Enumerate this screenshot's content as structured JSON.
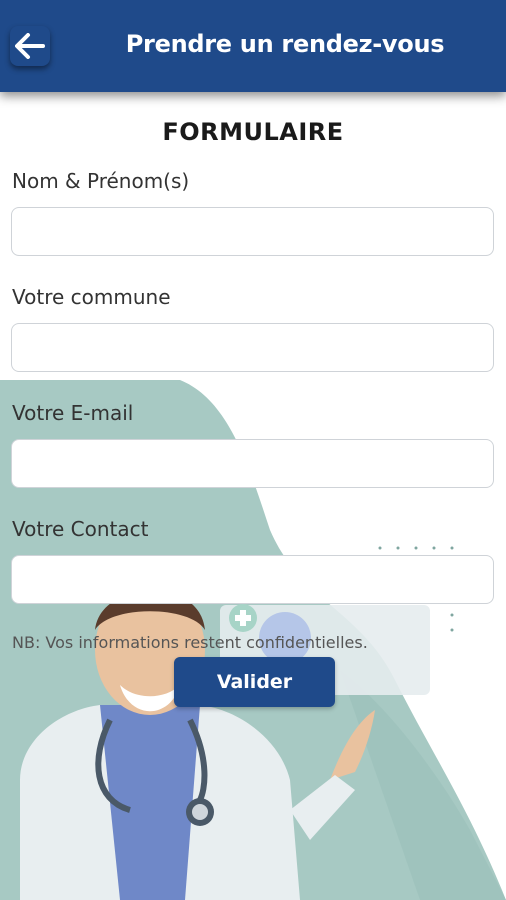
{
  "header": {
    "title": "Prendre un rendez-vous",
    "back_icon": "arrow-left-icon",
    "color": "#1f4a8a"
  },
  "form": {
    "title": "FORMULAIRE",
    "fields": [
      {
        "label": "Nom & Prénom(s)",
        "value": "",
        "placeholder": ""
      },
      {
        "label": "Votre commune",
        "value": "",
        "placeholder": ""
      },
      {
        "label": "Votre E-mail",
        "value": "",
        "placeholder": ""
      },
      {
        "label": "Votre Contact",
        "value": "",
        "placeholder": ""
      }
    ],
    "note": "NB: Vos informations restent confidentielles.",
    "submit_label": "Valider"
  },
  "illustration": {
    "subject": "doctor-illustration",
    "accent": "#9fc3bd"
  }
}
